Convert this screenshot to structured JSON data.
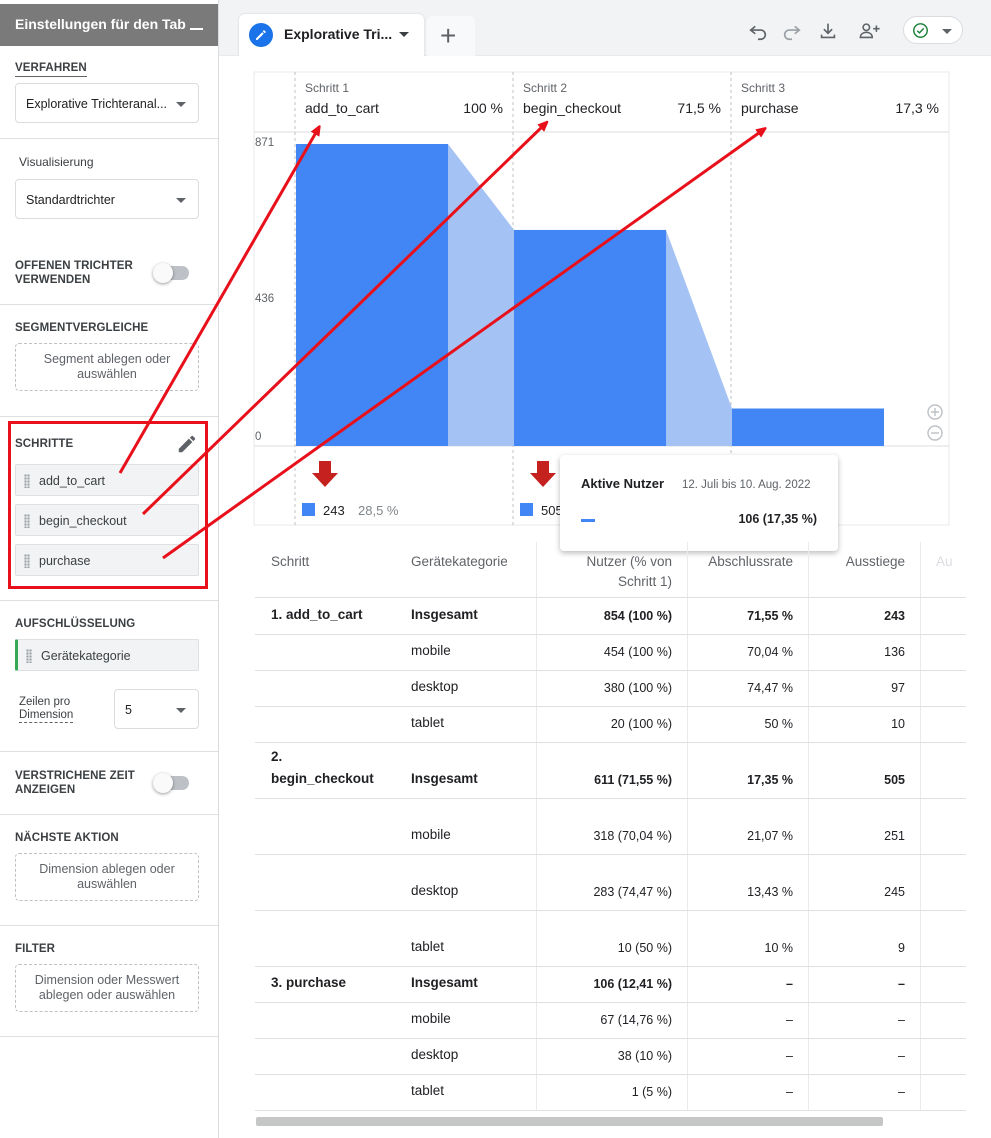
{
  "sidebar": {
    "title": "Einstellungen für den Tab",
    "technique_label": "VERFAHREN",
    "technique_value": "Explorative Trichteranal...",
    "visualization_label": "Visualisierung",
    "visualization_value": "Standardtrichter",
    "open_funnel_label": [
      "OFFENEN TRICHTER",
      "VERWENDEN"
    ],
    "segments_label": "SEGMENTVERGLEICHE",
    "segments_drop": [
      "Segment ablegen oder",
      "auswählen"
    ],
    "steps_label": "SCHRITTE",
    "steps": [
      "add_to_cart",
      "begin_checkout",
      "purchase"
    ],
    "breakdown_label": "AUFSCHLÜSSELUNG",
    "breakdown_value": "Gerätekategorie",
    "rows_label": [
      "Zeilen pro",
      "Dimension"
    ],
    "rows_value": "5",
    "elapsed_label": [
      "VERSTRICHENE ZEIT",
      "ANZEIGEN"
    ],
    "next_action_label": "NÄCHSTE AKTION",
    "next_action_drop": [
      "Dimension ablegen oder",
      "auswählen"
    ],
    "filter_label": "FILTER",
    "filter_drop": [
      "Dimension oder Messwert",
      "ablegen oder auswählen"
    ]
  },
  "tabbar": {
    "tab_label": "Explorative Tri...",
    "add_symbol": "+"
  },
  "chart_data": {
    "type": "bar",
    "y_ticks": [
      "871",
      "436",
      "0"
    ],
    "ylim": [
      0,
      871
    ],
    "steps": [
      {
        "num": "Schritt 1",
        "name": "add_to_cart",
        "pct": "100 %",
        "users": 854,
        "drop_count": "243",
        "drop_pct": "28,5 %"
      },
      {
        "num": "Schritt 2",
        "name": "begin_checkout",
        "pct": "71,5 %",
        "users": 611,
        "drop_count": "505",
        "drop_pct": ""
      },
      {
        "num": "Schritt 3",
        "name": "purchase",
        "pct": "17,3 %",
        "users": 106,
        "drop_count": "",
        "drop_pct": ""
      }
    ],
    "colors": {
      "bar": "#4285f4",
      "flow": "#a4c2f4",
      "drop_arrow": "#c5221f",
      "annotation": "#e8101a"
    }
  },
  "tooltip": {
    "metric": "Aktive Nutzer",
    "date_range": "12. Juli bis 10. Aug. 2022",
    "value": "106 (17,35 %)"
  },
  "table": {
    "headers": {
      "step": "Schritt",
      "device": "Gerätekategorie",
      "users": [
        "Nutzer (% von",
        "Schritt 1)"
      ],
      "completion": "Abschlussrate",
      "exits": "Ausstiege",
      "cut": "Au"
    },
    "groups": [
      {
        "step": [
          "1. add_to_cart"
        ],
        "rows": [
          {
            "device": "Insgesamt",
            "users": "854 (100 %)",
            "completion": "71,55 %",
            "exits": "243"
          },
          {
            "device": "mobile",
            "users": "454 (100 %)",
            "completion": "70,04 %",
            "exits": "136"
          },
          {
            "device": "desktop",
            "users": "380 (100 %)",
            "completion": "74,47 %",
            "exits": "97"
          },
          {
            "device": "tablet",
            "users": "20 (100 %)",
            "completion": "50 %",
            "exits": "10"
          }
        ]
      },
      {
        "step": [
          "2.",
          "begin_checkout"
        ],
        "rows": [
          {
            "device": "Insgesamt",
            "users": "611 (71,55 %)",
            "completion": "17,35 %",
            "exits": "505"
          },
          {
            "device": "mobile",
            "users": "318 (70,04 %)",
            "completion": "21,07 %",
            "exits": "251"
          },
          {
            "device": "desktop",
            "users": "283 (74,47 %)",
            "completion": "13,43 %",
            "exits": "245"
          },
          {
            "device": "tablet",
            "users": "10 (50 %)",
            "completion": "10 %",
            "exits": "9"
          }
        ]
      },
      {
        "step": [
          "3. purchase"
        ],
        "rows": [
          {
            "device": "Insgesamt",
            "users": "106 (12,41 %)",
            "completion": "–",
            "exits": "–"
          },
          {
            "device": "mobile",
            "users": "67 (14,76 %)",
            "completion": "–",
            "exits": "–"
          },
          {
            "device": "desktop",
            "users": "38 (10 %)",
            "completion": "–",
            "exits": "–"
          },
          {
            "device": "tablet",
            "users": "1 (5 %)",
            "completion": "–",
            "exits": "–"
          }
        ]
      }
    ]
  }
}
